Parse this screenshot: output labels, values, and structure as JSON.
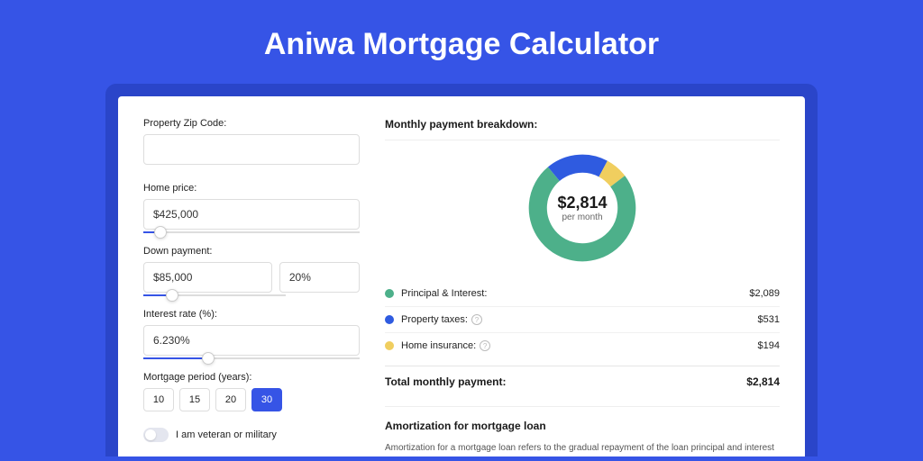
{
  "title": "Aniwa Mortgage Calculator",
  "form": {
    "zip": {
      "label": "Property Zip Code:",
      "value": ""
    },
    "home_price": {
      "label": "Home price:",
      "value": "$425,000",
      "slider_pct": 8
    },
    "down_payment": {
      "label": "Down payment:",
      "amount": "$85,000",
      "percent": "20%",
      "slider_pct": 20
    },
    "interest": {
      "label": "Interest rate (%):",
      "value": "6.230%",
      "slider_pct": 30
    },
    "period": {
      "label": "Mortgage period (years):",
      "options": [
        "10",
        "15",
        "20",
        "30"
      ],
      "selected": "30"
    },
    "veteran": {
      "label": "I am veteran or military",
      "on": false
    }
  },
  "breakdown": {
    "title": "Monthly payment breakdown:",
    "total": "$2,814",
    "per_month": "per month",
    "items": [
      {
        "key": "principal",
        "label": "Principal & Interest:",
        "value": "$2,089",
        "color": "#4db08a",
        "info": false
      },
      {
        "key": "taxes",
        "label": "Property taxes:",
        "value": "$531",
        "color": "#2f5be0",
        "info": true
      },
      {
        "key": "insurance",
        "label": "Home insurance:",
        "value": "$194",
        "color": "#f0ce5f",
        "info": true
      }
    ],
    "total_label": "Total monthly payment:",
    "total_value": "$2,814"
  },
  "chart_data": {
    "type": "pie",
    "title": "Monthly payment breakdown",
    "categories": [
      "Principal & Interest",
      "Property taxes",
      "Home insurance"
    ],
    "values": [
      2089,
      531,
      194
    ],
    "colors": [
      "#4db08a",
      "#2f5be0",
      "#f0ce5f"
    ],
    "center_label": "$2,814 per month"
  },
  "amortization": {
    "title": "Amortization for mortgage loan",
    "text": "Amortization for a mortgage loan refers to the gradual repayment of the loan principal and interest over a specified"
  }
}
